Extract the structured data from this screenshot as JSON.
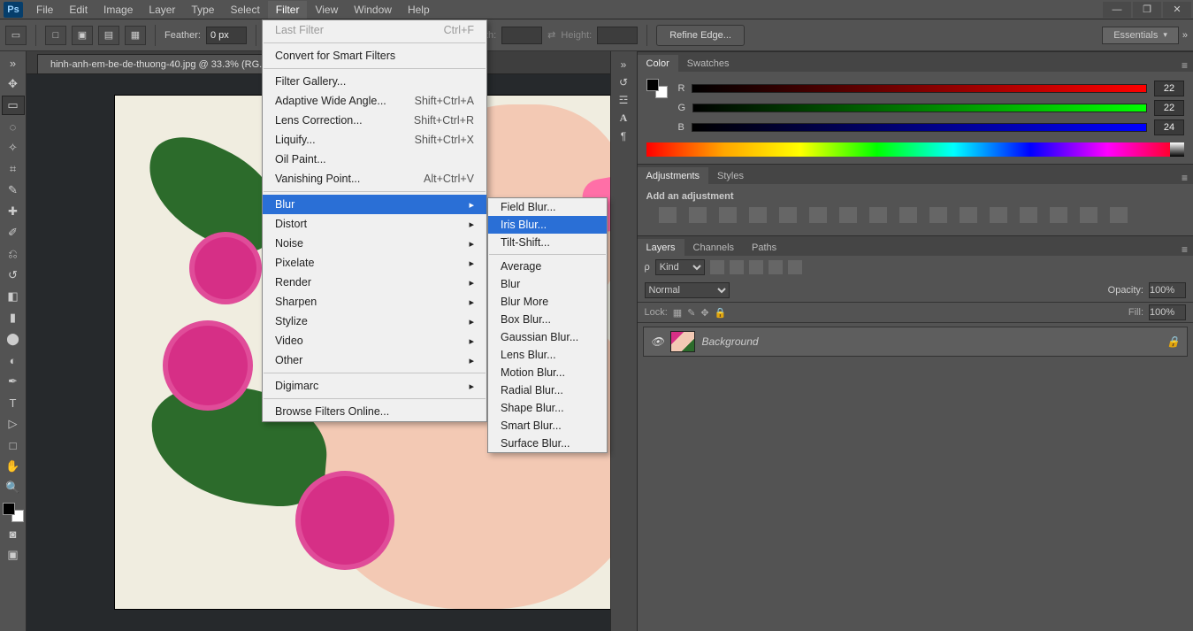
{
  "menubar": {
    "items": [
      "File",
      "Edit",
      "Image",
      "Layer",
      "Type",
      "Select",
      "Filter",
      "View",
      "Window",
      "Help"
    ],
    "open_index": 6
  },
  "window_controls": {
    "min": "—",
    "restore": "❐",
    "close": "✕"
  },
  "optionsbar": {
    "feather_label": "Feather:",
    "feather_value": "0 px",
    "width_label": "Width:",
    "height_label": "Height:",
    "refine_edge": "Refine Edge..."
  },
  "workspace": {
    "label": "Essentials"
  },
  "document": {
    "tab": "hinh-anh-em-be-de-thuong-40.jpg @ 33.3% (RG..."
  },
  "dropdown": {
    "groups": [
      [
        {
          "label": "Last Filter",
          "shortcut": "Ctrl+F",
          "disabled": true
        }
      ],
      [
        {
          "label": "Convert for Smart Filters"
        }
      ],
      [
        {
          "label": "Filter Gallery..."
        },
        {
          "label": "Adaptive Wide Angle...",
          "shortcut": "Shift+Ctrl+A"
        },
        {
          "label": "Lens Correction...",
          "shortcut": "Shift+Ctrl+R"
        },
        {
          "label": "Liquify...",
          "shortcut": "Shift+Ctrl+X"
        },
        {
          "label": "Oil Paint..."
        },
        {
          "label": "Vanishing Point...",
          "shortcut": "Alt+Ctrl+V"
        }
      ],
      [
        {
          "label": "Blur",
          "submenu": true,
          "highlight": true
        },
        {
          "label": "Distort",
          "submenu": true
        },
        {
          "label": "Noise",
          "submenu": true
        },
        {
          "label": "Pixelate",
          "submenu": true
        },
        {
          "label": "Render",
          "submenu": true
        },
        {
          "label": "Sharpen",
          "submenu": true
        },
        {
          "label": "Stylize",
          "submenu": true
        },
        {
          "label": "Video",
          "submenu": true
        },
        {
          "label": "Other",
          "submenu": true
        }
      ],
      [
        {
          "label": "Digimarc",
          "submenu": true
        }
      ],
      [
        {
          "label": "Browse Filters Online..."
        }
      ]
    ]
  },
  "submenu": {
    "groups": [
      [
        {
          "label": "Field Blur..."
        },
        {
          "label": "Iris Blur...",
          "highlight": true
        },
        {
          "label": "Tilt-Shift..."
        }
      ],
      [
        {
          "label": "Average"
        },
        {
          "label": "Blur"
        },
        {
          "label": "Blur More"
        },
        {
          "label": "Box Blur..."
        },
        {
          "label": "Gaussian Blur..."
        },
        {
          "label": "Lens Blur..."
        },
        {
          "label": "Motion Blur..."
        },
        {
          "label": "Radial Blur..."
        },
        {
          "label": "Shape Blur..."
        },
        {
          "label": "Smart Blur..."
        },
        {
          "label": "Surface Blur..."
        }
      ]
    ]
  },
  "panels": {
    "color": {
      "tabs": [
        "Color",
        "Swatches"
      ],
      "r_label": "R",
      "r_value": "22",
      "g_label": "G",
      "g_value": "22",
      "b_label": "B",
      "b_value": "24"
    },
    "adjust": {
      "tabs": [
        "Adjustments",
        "Styles"
      ],
      "heading": "Add an adjustment"
    },
    "layers": {
      "tabs": [
        "Layers",
        "Channels",
        "Paths"
      ],
      "kind_prefix": "ρ",
      "kind_label": "Kind",
      "blend_mode": "Normal",
      "opacity_label": "Opacity:",
      "opacity_value": "100%",
      "lock_label": "Lock:",
      "fill_label": "Fill:",
      "fill_value": "100%",
      "layer_name": "Background"
    }
  }
}
